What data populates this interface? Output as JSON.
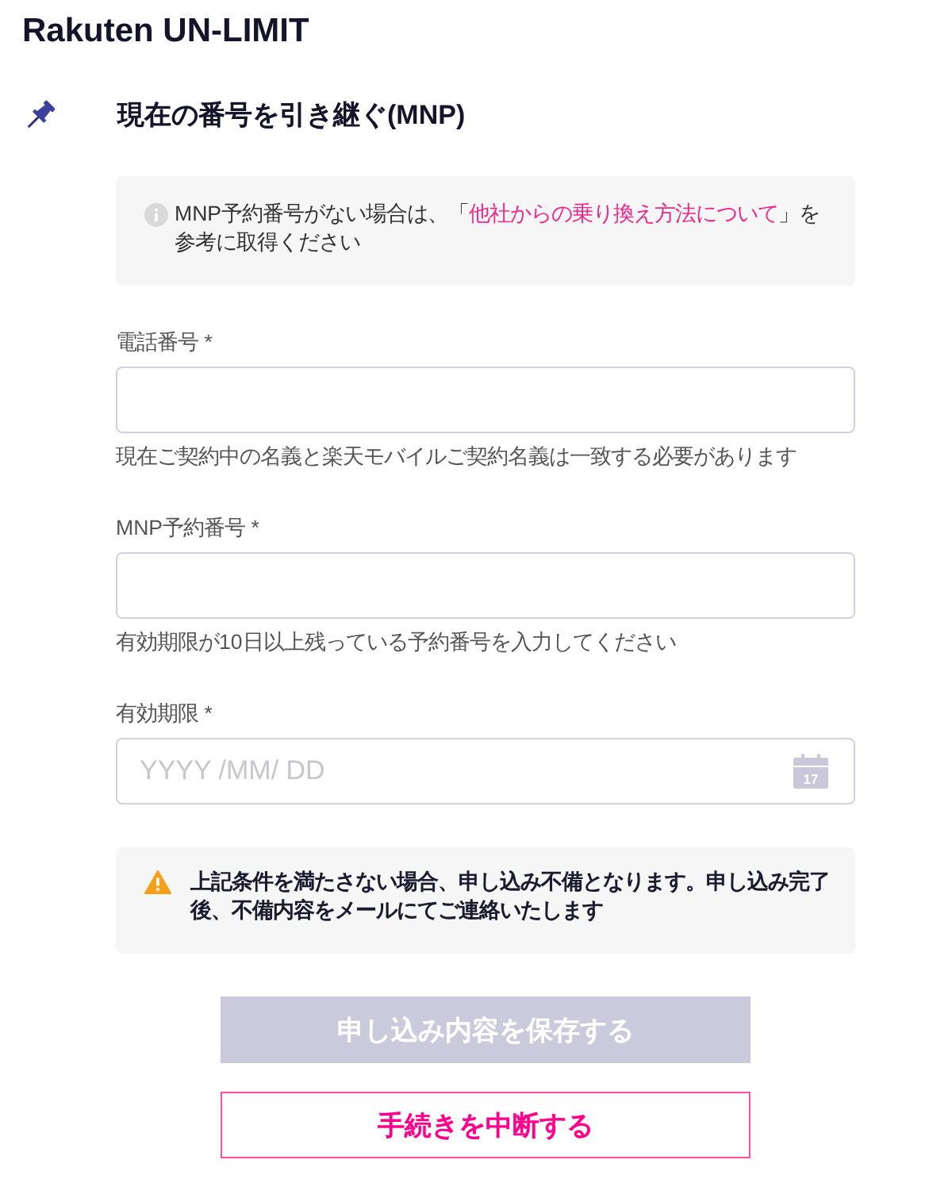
{
  "app_title": "Rakuten UN-LIMIT",
  "section": {
    "title": "現在の番号を引き継ぐ(MNP)"
  },
  "info_notice": {
    "kind": "info",
    "text_before": "MNP予約番号がない場合は、「",
    "link": "他社からの乗り換え方法について",
    "text_after": "」を参考に取得ください"
  },
  "fields": [
    {
      "kind": "text",
      "label": "電話番号 *",
      "hint": "現在ご契約中の名義と楽天モバイルご契約名義は一致する必要があります"
    },
    {
      "kind": "text",
      "label": "MNP予約番号 *",
      "hint": "有効期限が10日以上残っている予約番号を入力してください"
    },
    {
      "kind": "date",
      "label": "有効期限 *",
      "placeholder": "YYYY /MM/ DD",
      "calendar_day": "17"
    }
  ],
  "warning_notice": {
    "kind": "warning",
    "text": "上記条件を満たさない場合、申し込み不備となります。申し込み完了後、不備内容をメールにてご連絡いたします"
  },
  "buttons": [
    {
      "kind": "filled",
      "label": "申し込み内容を保存する",
      "disabled": true
    },
    {
      "kind": "outline",
      "label": "手続きを中断する",
      "disabled": false
    }
  ]
}
